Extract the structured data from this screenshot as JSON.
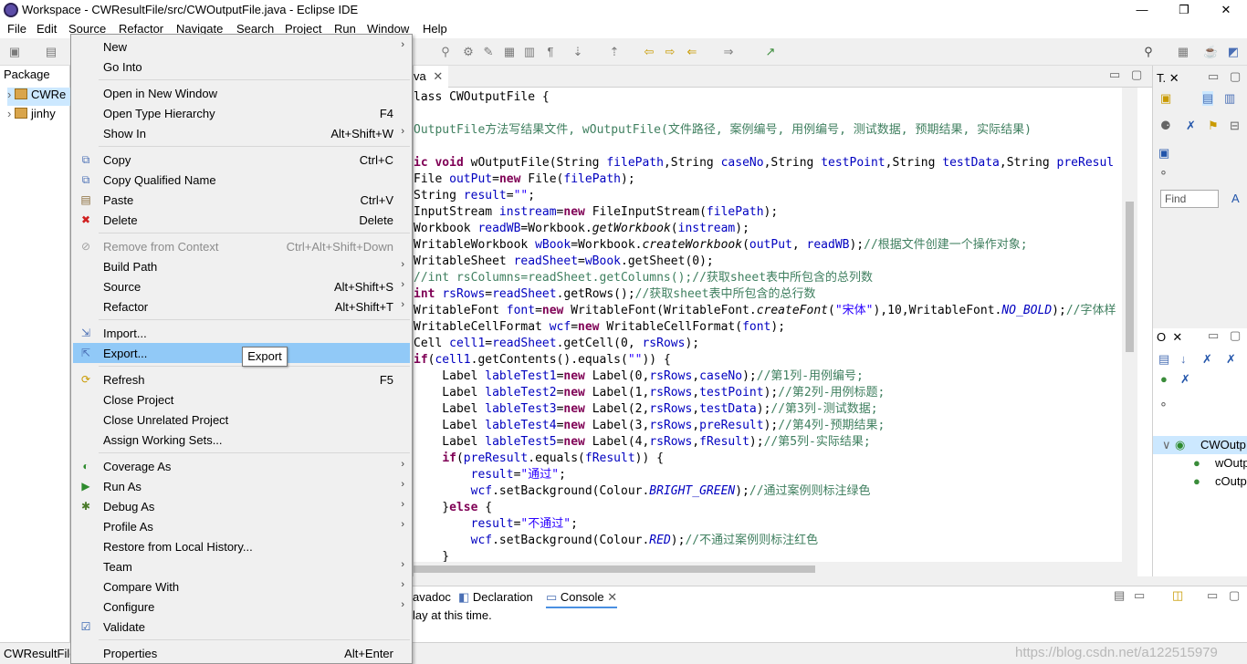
{
  "window": {
    "title": "Workspace - CWResultFile/src/CWOutputFile.java - Eclipse IDE",
    "controls": {
      "minimize": "—",
      "restore": "❐",
      "close": "✕"
    }
  },
  "menubar": [
    "File",
    "Edit",
    "Source",
    "Refactor",
    "Navigate",
    "Search",
    "Project",
    "Run",
    "Window",
    "Help"
  ],
  "package_explorer": {
    "tab": "Package",
    "items": [
      "CWRe",
      "jinhy"
    ]
  },
  "editor": {
    "tab_label": "va",
    "code_lines": [
      [
        {
          "t": "lass CWOutputFile {",
          "c": ""
        }
      ],
      [
        {
          "t": "",
          "c": ""
        }
      ],
      [
        {
          "t": "OutputFile方法写结果文件, wOutputFile(文件路径, 案例编号, 用例编号, 测试数据, 预期结果, 实际结果)",
          "c": "cm"
        }
      ],
      [
        {
          "t": "",
          "c": ""
        }
      ],
      [
        {
          "t": "ic void ",
          "c": "kw"
        },
        {
          "t": "wOutputFile(String ",
          "c": ""
        },
        {
          "t": "filePath",
          "c": "var"
        },
        {
          "t": ",String ",
          "c": ""
        },
        {
          "t": "caseNo",
          "c": "var"
        },
        {
          "t": ",String ",
          "c": ""
        },
        {
          "t": "testPoint",
          "c": "var"
        },
        {
          "t": ",String ",
          "c": ""
        },
        {
          "t": "testData",
          "c": "var"
        },
        {
          "t": ",String ",
          "c": ""
        },
        {
          "t": "preResul",
          "c": "var"
        }
      ],
      [
        {
          "t": "File ",
          "c": ""
        },
        {
          "t": "outPut",
          "c": "var"
        },
        {
          "t": "=",
          "c": ""
        },
        {
          "t": "new ",
          "c": "kw"
        },
        {
          "t": "File(",
          "c": ""
        },
        {
          "t": "filePath",
          "c": "var"
        },
        {
          "t": ");",
          "c": ""
        }
      ],
      [
        {
          "t": "String ",
          "c": ""
        },
        {
          "t": "result",
          "c": "var"
        },
        {
          "t": "=",
          "c": ""
        },
        {
          "t": "\"\"",
          "c": "str"
        },
        {
          "t": ";",
          "c": ""
        }
      ],
      [
        {
          "t": "InputStream ",
          "c": ""
        },
        {
          "t": "instream",
          "c": "var"
        },
        {
          "t": "=",
          "c": ""
        },
        {
          "t": "new ",
          "c": "kw"
        },
        {
          "t": "FileInputStream(",
          "c": ""
        },
        {
          "t": "filePath",
          "c": "var"
        },
        {
          "t": ");",
          "c": ""
        }
      ],
      [
        {
          "t": "Workbook ",
          "c": ""
        },
        {
          "t": "readWB",
          "c": "var"
        },
        {
          "t": "=Workbook.",
          "c": ""
        },
        {
          "t": "getWorkbook",
          "c": "it"
        },
        {
          "t": "(",
          "c": ""
        },
        {
          "t": "instream",
          "c": "var"
        },
        {
          "t": ");",
          "c": ""
        }
      ],
      [
        {
          "t": "WritableWorkbook ",
          "c": ""
        },
        {
          "t": "wBook",
          "c": "var"
        },
        {
          "t": "=Workbook.",
          "c": ""
        },
        {
          "t": "createWorkbook",
          "c": "it"
        },
        {
          "t": "(",
          "c": ""
        },
        {
          "t": "outPut",
          "c": "var"
        },
        {
          "t": ", ",
          "c": ""
        },
        {
          "t": "readWB",
          "c": "var"
        },
        {
          "t": ");",
          "c": ""
        },
        {
          "t": "//根据文件创建一个操作对象;",
          "c": "cm"
        }
      ],
      [
        {
          "t": "WritableSheet ",
          "c": ""
        },
        {
          "t": "readSheet",
          "c": "var"
        },
        {
          "t": "=",
          "c": ""
        },
        {
          "t": "wBook",
          "c": "var"
        },
        {
          "t": ".getSheet(0);",
          "c": ""
        }
      ],
      [
        {
          "t": "//int rsColumns=readSheet.getColumns();//获取sheet表中所包含的总列数",
          "c": "cm"
        }
      ],
      [
        {
          "t": "int ",
          "c": "kw"
        },
        {
          "t": "rsRows",
          "c": "var"
        },
        {
          "t": "=",
          "c": ""
        },
        {
          "t": "readSheet",
          "c": "var"
        },
        {
          "t": ".getRows();",
          "c": ""
        },
        {
          "t": "//获取sheet表中所包含的总行数",
          "c": "cm"
        }
      ],
      [
        {
          "t": "WritableFont ",
          "c": ""
        },
        {
          "t": "font",
          "c": "var"
        },
        {
          "t": "=",
          "c": ""
        },
        {
          "t": "new ",
          "c": "kw"
        },
        {
          "t": "WritableFont(WritableFont.",
          "c": ""
        },
        {
          "t": "createFont",
          "c": "it"
        },
        {
          "t": "(",
          "c": ""
        },
        {
          "t": "\"宋体\"",
          "c": "str"
        },
        {
          "t": "),10,WritableFont.",
          "c": ""
        },
        {
          "t": "NO_BOLD",
          "c": "var it"
        },
        {
          "t": ");",
          "c": ""
        },
        {
          "t": "//字体样",
          "c": "cm"
        }
      ],
      [
        {
          "t": "WritableCellFormat ",
          "c": ""
        },
        {
          "t": "wcf",
          "c": "var"
        },
        {
          "t": "=",
          "c": ""
        },
        {
          "t": "new ",
          "c": "kw"
        },
        {
          "t": "WritableCellFormat(",
          "c": ""
        },
        {
          "t": "font",
          "c": "var"
        },
        {
          "t": ");",
          "c": ""
        }
      ],
      [
        {
          "t": "Cell ",
          "c": ""
        },
        {
          "t": "cell1",
          "c": "var"
        },
        {
          "t": "=",
          "c": ""
        },
        {
          "t": "readSheet",
          "c": "var"
        },
        {
          "t": ".getCell(0, ",
          "c": ""
        },
        {
          "t": "rsRows",
          "c": "var"
        },
        {
          "t": ");",
          "c": ""
        }
      ],
      [
        {
          "t": "if",
          "c": "kw"
        },
        {
          "t": "(",
          "c": ""
        },
        {
          "t": "cell1",
          "c": "var"
        },
        {
          "t": ".getContents().equals(",
          "c": ""
        },
        {
          "t": "\"\"",
          "c": "str"
        },
        {
          "t": ")) {",
          "c": ""
        }
      ],
      [
        {
          "t": "    Label ",
          "c": ""
        },
        {
          "t": "lableTest1",
          "c": "var"
        },
        {
          "t": "=",
          "c": ""
        },
        {
          "t": "new ",
          "c": "kw"
        },
        {
          "t": "Label(0,",
          "c": ""
        },
        {
          "t": "rsRows",
          "c": "var"
        },
        {
          "t": ",",
          "c": ""
        },
        {
          "t": "caseNo",
          "c": "var"
        },
        {
          "t": ");",
          "c": ""
        },
        {
          "t": "//第1列-用例编号;",
          "c": "cm"
        }
      ],
      [
        {
          "t": "    Label ",
          "c": ""
        },
        {
          "t": "lableTest2",
          "c": "var"
        },
        {
          "t": "=",
          "c": ""
        },
        {
          "t": "new ",
          "c": "kw"
        },
        {
          "t": "Label(1,",
          "c": ""
        },
        {
          "t": "rsRows",
          "c": "var"
        },
        {
          "t": ",",
          "c": ""
        },
        {
          "t": "testPoint",
          "c": "var"
        },
        {
          "t": ");",
          "c": ""
        },
        {
          "t": "//第2列-用例标题;",
          "c": "cm"
        }
      ],
      [
        {
          "t": "    Label ",
          "c": ""
        },
        {
          "t": "lableTest3",
          "c": "var"
        },
        {
          "t": "=",
          "c": ""
        },
        {
          "t": "new ",
          "c": "kw"
        },
        {
          "t": "Label(2,",
          "c": ""
        },
        {
          "t": "rsRows",
          "c": "var"
        },
        {
          "t": ",",
          "c": ""
        },
        {
          "t": "testData",
          "c": "var"
        },
        {
          "t": ");",
          "c": ""
        },
        {
          "t": "//第3列-测试数据;",
          "c": "cm"
        }
      ],
      [
        {
          "t": "    Label ",
          "c": ""
        },
        {
          "t": "lableTest4",
          "c": "var"
        },
        {
          "t": "=",
          "c": ""
        },
        {
          "t": "new ",
          "c": "kw"
        },
        {
          "t": "Label(3,",
          "c": ""
        },
        {
          "t": "rsRows",
          "c": "var"
        },
        {
          "t": ",",
          "c": ""
        },
        {
          "t": "preResult",
          "c": "var"
        },
        {
          "t": ");",
          "c": ""
        },
        {
          "t": "//第4列-预期结果;",
          "c": "cm"
        }
      ],
      [
        {
          "t": "    Label ",
          "c": ""
        },
        {
          "t": "lableTest5",
          "c": "var"
        },
        {
          "t": "=",
          "c": ""
        },
        {
          "t": "new ",
          "c": "kw"
        },
        {
          "t": "Label(4,",
          "c": ""
        },
        {
          "t": "rsRows",
          "c": "var"
        },
        {
          "t": ",",
          "c": ""
        },
        {
          "t": "fResult",
          "c": "var"
        },
        {
          "t": ");",
          "c": ""
        },
        {
          "t": "//第5列-实际结果;",
          "c": "cm"
        }
      ],
      [
        {
          "t": "    ",
          "c": ""
        },
        {
          "t": "if",
          "c": "kw"
        },
        {
          "t": "(",
          "c": ""
        },
        {
          "t": "preResult",
          "c": "var"
        },
        {
          "t": ".equals(",
          "c": ""
        },
        {
          "t": "fResult",
          "c": "var"
        },
        {
          "t": ")) {",
          "c": ""
        }
      ],
      [
        {
          "t": "        ",
          "c": ""
        },
        {
          "t": "result",
          "c": "var"
        },
        {
          "t": "=",
          "c": ""
        },
        {
          "t": "\"通过\"",
          "c": "str"
        },
        {
          "t": ";",
          "c": ""
        }
      ],
      [
        {
          "t": "        ",
          "c": ""
        },
        {
          "t": "wcf",
          "c": "var"
        },
        {
          "t": ".setBackground(Colour.",
          "c": ""
        },
        {
          "t": "BRIGHT_GREEN",
          "c": "var it"
        },
        {
          "t": ");",
          "c": ""
        },
        {
          "t": "//通过案例则标注绿色",
          "c": "cm"
        }
      ],
      [
        {
          "t": "    }",
          "c": ""
        },
        {
          "t": "else ",
          "c": "kw"
        },
        {
          "t": "{",
          "c": ""
        }
      ],
      [
        {
          "t": "        ",
          "c": ""
        },
        {
          "t": "result",
          "c": "var"
        },
        {
          "t": "=",
          "c": ""
        },
        {
          "t": "\"不通过\"",
          "c": "str"
        },
        {
          "t": ";",
          "c": ""
        }
      ],
      [
        {
          "t": "        ",
          "c": ""
        },
        {
          "t": "wcf",
          "c": "var"
        },
        {
          "t": ".setBackground(Colour.",
          "c": ""
        },
        {
          "t": "RED",
          "c": "var it"
        },
        {
          "t": ");",
          "c": ""
        },
        {
          "t": "//不通过案例则标注红色",
          "c": "cm"
        }
      ],
      [
        {
          "t": "    }",
          "c": ""
        }
      ]
    ]
  },
  "bottom_panel": {
    "tabs": [
      "avadoc",
      "Declaration",
      "Console"
    ],
    "console_text": "lay at this time."
  },
  "right_panels": {
    "task_tab": "T",
    "find_placeholder": "Find",
    "find_extra": "A",
    "outline_tab": "O",
    "outline_items": [
      "CWOutp",
      "wOutp",
      "cOutp"
    ]
  },
  "context_menu": {
    "items": [
      {
        "label": "New",
        "shortcut": "",
        "submenu": true,
        "icon": "",
        "disabled": false
      },
      {
        "label": "Go Into",
        "shortcut": "",
        "submenu": false,
        "icon": "",
        "disabled": false
      },
      {
        "sep": true
      },
      {
        "label": "Open in New Window",
        "shortcut": "",
        "submenu": false,
        "icon": "",
        "disabled": false
      },
      {
        "label": "Open Type Hierarchy",
        "shortcut": "F4",
        "submenu": false,
        "icon": "",
        "disabled": false
      },
      {
        "label": "Show In",
        "shortcut": "Alt+Shift+W",
        "submenu": true,
        "icon": "",
        "disabled": false
      },
      {
        "sep": true
      },
      {
        "label": "Copy",
        "shortcut": "Ctrl+C",
        "submenu": false,
        "icon": "copy",
        "disabled": false
      },
      {
        "label": "Copy Qualified Name",
        "shortcut": "",
        "submenu": false,
        "icon": "copy",
        "disabled": false
      },
      {
        "label": "Paste",
        "shortcut": "Ctrl+V",
        "submenu": false,
        "icon": "paste",
        "disabled": false
      },
      {
        "label": "Delete",
        "shortcut": "Delete",
        "submenu": false,
        "icon": "delete",
        "disabled": false
      },
      {
        "sep": true
      },
      {
        "label": "Remove from Context",
        "shortcut": "Ctrl+Alt+Shift+Down",
        "submenu": false,
        "icon": "remove",
        "disabled": true
      },
      {
        "label": "Build Path",
        "shortcut": "",
        "submenu": true,
        "icon": "",
        "disabled": false
      },
      {
        "label": "Source",
        "shortcut": "Alt+Shift+S",
        "submenu": true,
        "icon": "",
        "disabled": false
      },
      {
        "label": "Refactor",
        "shortcut": "Alt+Shift+T",
        "submenu": true,
        "icon": "",
        "disabled": false
      },
      {
        "sep": true
      },
      {
        "label": "Import...",
        "shortcut": "",
        "submenu": false,
        "icon": "import",
        "disabled": false
      },
      {
        "label": "Export...",
        "shortcut": "",
        "submenu": false,
        "icon": "export",
        "disabled": false,
        "highlight": true
      },
      {
        "sep": true
      },
      {
        "label": "Refresh",
        "shortcut": "F5",
        "submenu": false,
        "icon": "refresh",
        "disabled": false
      },
      {
        "label": "Close Project",
        "shortcut": "",
        "submenu": false,
        "icon": "",
        "disabled": false
      },
      {
        "label": "Close Unrelated Project",
        "shortcut": "",
        "submenu": false,
        "icon": "",
        "disabled": false
      },
      {
        "label": "Assign Working Sets...",
        "shortcut": "",
        "submenu": false,
        "icon": "",
        "disabled": false
      },
      {
        "sep": true
      },
      {
        "label": "Coverage As",
        "shortcut": "",
        "submenu": true,
        "icon": "coverage",
        "disabled": false
      },
      {
        "label": "Run As",
        "shortcut": "",
        "submenu": true,
        "icon": "run",
        "disabled": false
      },
      {
        "label": "Debug As",
        "shortcut": "",
        "submenu": true,
        "icon": "debug",
        "disabled": false
      },
      {
        "label": "Profile As",
        "shortcut": "",
        "submenu": true,
        "icon": "",
        "disabled": false
      },
      {
        "label": "Restore from Local History...",
        "shortcut": "",
        "submenu": false,
        "icon": "",
        "disabled": false
      },
      {
        "label": "Team",
        "shortcut": "",
        "submenu": true,
        "icon": "",
        "disabled": false
      },
      {
        "label": "Compare With",
        "shortcut": "",
        "submenu": true,
        "icon": "",
        "disabled": false
      },
      {
        "label": "Configure",
        "shortcut": "",
        "submenu": true,
        "icon": "",
        "disabled": false
      },
      {
        "label": "Validate",
        "shortcut": "",
        "submenu": false,
        "icon": "check",
        "disabled": false
      },
      {
        "sep": true
      },
      {
        "label": "Properties",
        "shortcut": "Alt+Enter",
        "submenu": false,
        "icon": "",
        "disabled": false
      }
    ]
  },
  "tooltip": "Export",
  "statusbar": {
    "left": "CWResultFile",
    "watermark": "https://blog.csdn.net/a122515979"
  },
  "colors": {
    "menu_highlight": "#91c9f7",
    "tree_selection": "#cce8ff",
    "keyword": "#7f0055",
    "comment": "#3f7f5f",
    "string": "#2a00ff",
    "field": "#0000c0"
  }
}
